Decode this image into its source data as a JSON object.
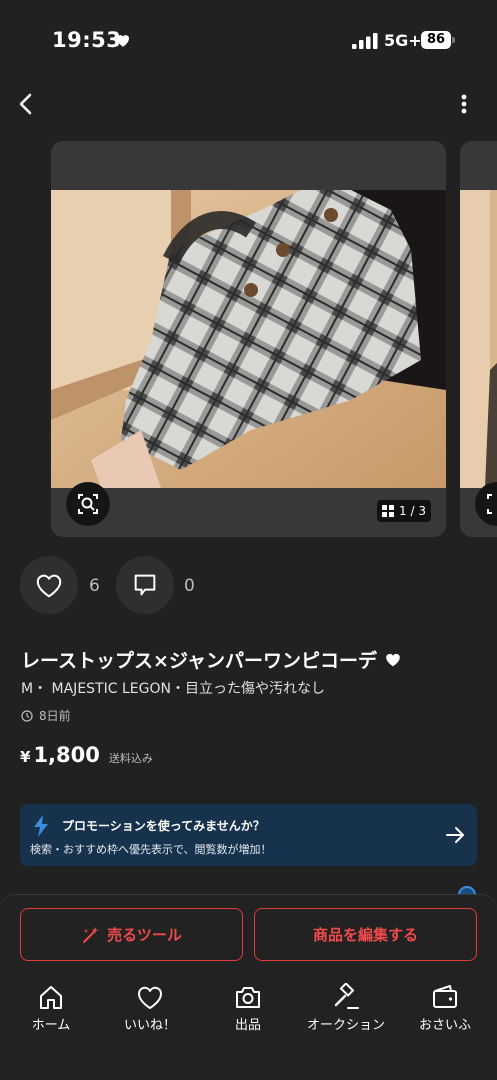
{
  "status_bar": {
    "time": "19:53",
    "network": "5G+",
    "battery": "86"
  },
  "gallery": {
    "counter": "1 / 3"
  },
  "reactions": {
    "likes": "6",
    "comments": "0"
  },
  "item": {
    "title": "レーストップス×ジャンパーワンピコーデ",
    "meta": "M・ MAJESTIC LEGON・目立った傷や汚れなし",
    "posted": "8日前",
    "currency": "¥",
    "price": "1,800",
    "shipping": "送料込み"
  },
  "promo": {
    "title": "プロモーションを使ってみませんか？",
    "subtitle": "検索・おすすめ枠へ優先表示で、閲覧数が増加！"
  },
  "actions": {
    "sell_tools": "売るツール",
    "edit_item": "商品を編集する"
  },
  "tabbar": [
    {
      "label": "ホーム",
      "icon": "home-icon"
    },
    {
      "label": "いいね！",
      "icon": "heart-icon"
    },
    {
      "label": "出品",
      "icon": "camera-icon"
    },
    {
      "label": "オークション",
      "icon": "gavel-icon"
    },
    {
      "label": "おさいふ",
      "icon": "wallet-icon"
    }
  ],
  "colors": {
    "background": "#212121",
    "accent_red": "#e23b3b",
    "promo_bg": "#17324d"
  }
}
